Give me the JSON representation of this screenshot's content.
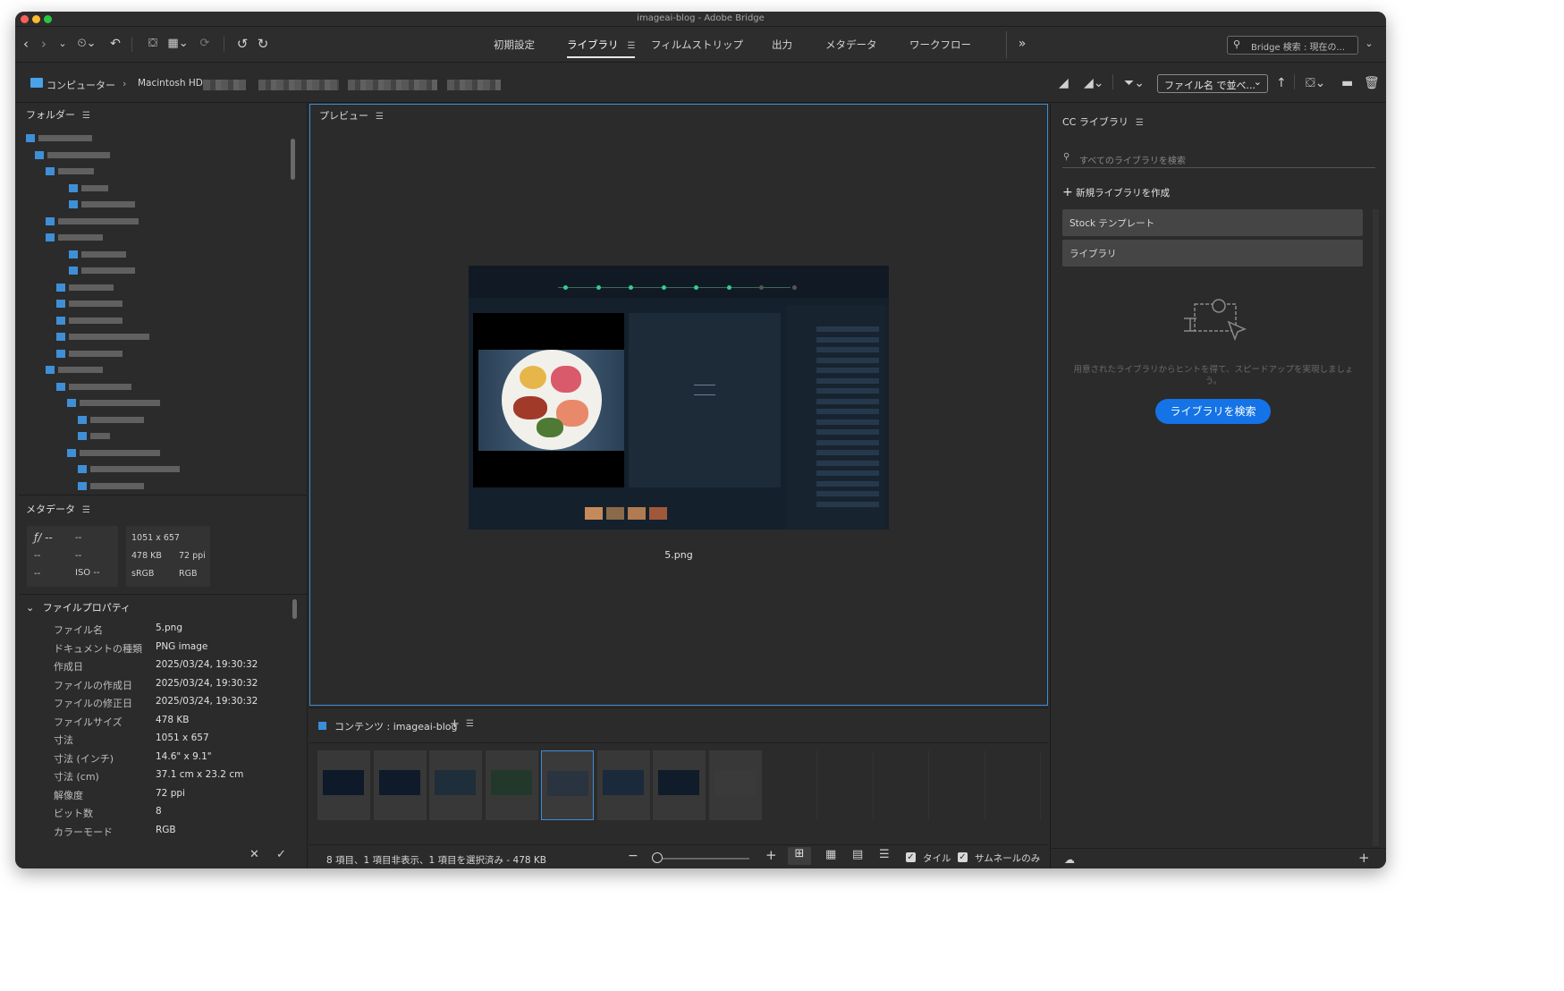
{
  "window": {
    "title": "imageai-blog - Adobe Bridge"
  },
  "workspaces": [
    {
      "label": "初期設定"
    },
    {
      "label": "ライブラリ",
      "active": true
    },
    {
      "label": "フィルムストリップ"
    },
    {
      "label": "出力"
    },
    {
      "label": "メタデータ"
    },
    {
      "label": "ワークフロー"
    }
  ],
  "search": {
    "placeholder": "Bridge 検索 : 現在の..."
  },
  "path": {
    "computer": "コンピューター",
    "separator": "›",
    "disk": "Macintosh HD"
  },
  "sort": {
    "label": "ファイル名 で並べ..."
  },
  "panels": {
    "folders": "フォルダー",
    "metadata": "メタデータ",
    "preview": "プレビュー",
    "content": "コンテンツ : imageai-blog",
    "cc": "CC ライブラリ"
  },
  "metadata_summary": {
    "aperture": "ƒ/ --",
    "shutter": "--",
    "dash1": "--",
    "dash2": "--",
    "dash3": "--",
    "iso": "ISO --",
    "dimensions": "1051 x 657",
    "size": "478 KB",
    "ppi": "72 ppi",
    "profile": "sRGB",
    "mode": "RGB"
  },
  "file_properties": {
    "title": "ファイルプロパティ",
    "rows": [
      {
        "key": "ファイル名",
        "value": "5.png"
      },
      {
        "key": "ドキュメントの種類",
        "value": "PNG image"
      },
      {
        "key": "作成日",
        "value": "2025/03/24, 19:30:32"
      },
      {
        "key": "ファイルの作成日",
        "value": "2025/03/24, 19:30:32"
      },
      {
        "key": "ファイルの修正日",
        "value": "2025/03/24, 19:30:32"
      },
      {
        "key": "ファイルサイズ",
        "value": "478 KB"
      },
      {
        "key": "寸法",
        "value": "1051 x 657"
      },
      {
        "key": "寸法 (インチ)",
        "value": "14.6\" x 9.1\""
      },
      {
        "key": "寸法 (cm)",
        "value": "37.1 cm x 23.2 cm"
      },
      {
        "key": "解像度",
        "value": "72 ppi"
      },
      {
        "key": "ビット数",
        "value": "8"
      },
      {
        "key": "カラーモード",
        "value": "RGB"
      }
    ]
  },
  "preview": {
    "filename": "5.png"
  },
  "content_status": "8 項目、1 項目非表示、1 項目を選択済み - 478 KB",
  "view_options": {
    "tile": "タイル",
    "thumbs_only": "サムネールのみ"
  },
  "cc_library": {
    "search_placeholder": "すべてのライブラリを検索",
    "create": "新規ライブラリを作成",
    "items": [
      "Stock テンプレート",
      "ライブラリ"
    ],
    "hint": "用意されたライブラリからヒントを得て、スピードアップを実現しましょう。",
    "button": "ライブラリを検索"
  },
  "colors": {
    "accent": "#3c8ed8",
    "button": "#1473e6",
    "bg": "#2b2b2b"
  }
}
